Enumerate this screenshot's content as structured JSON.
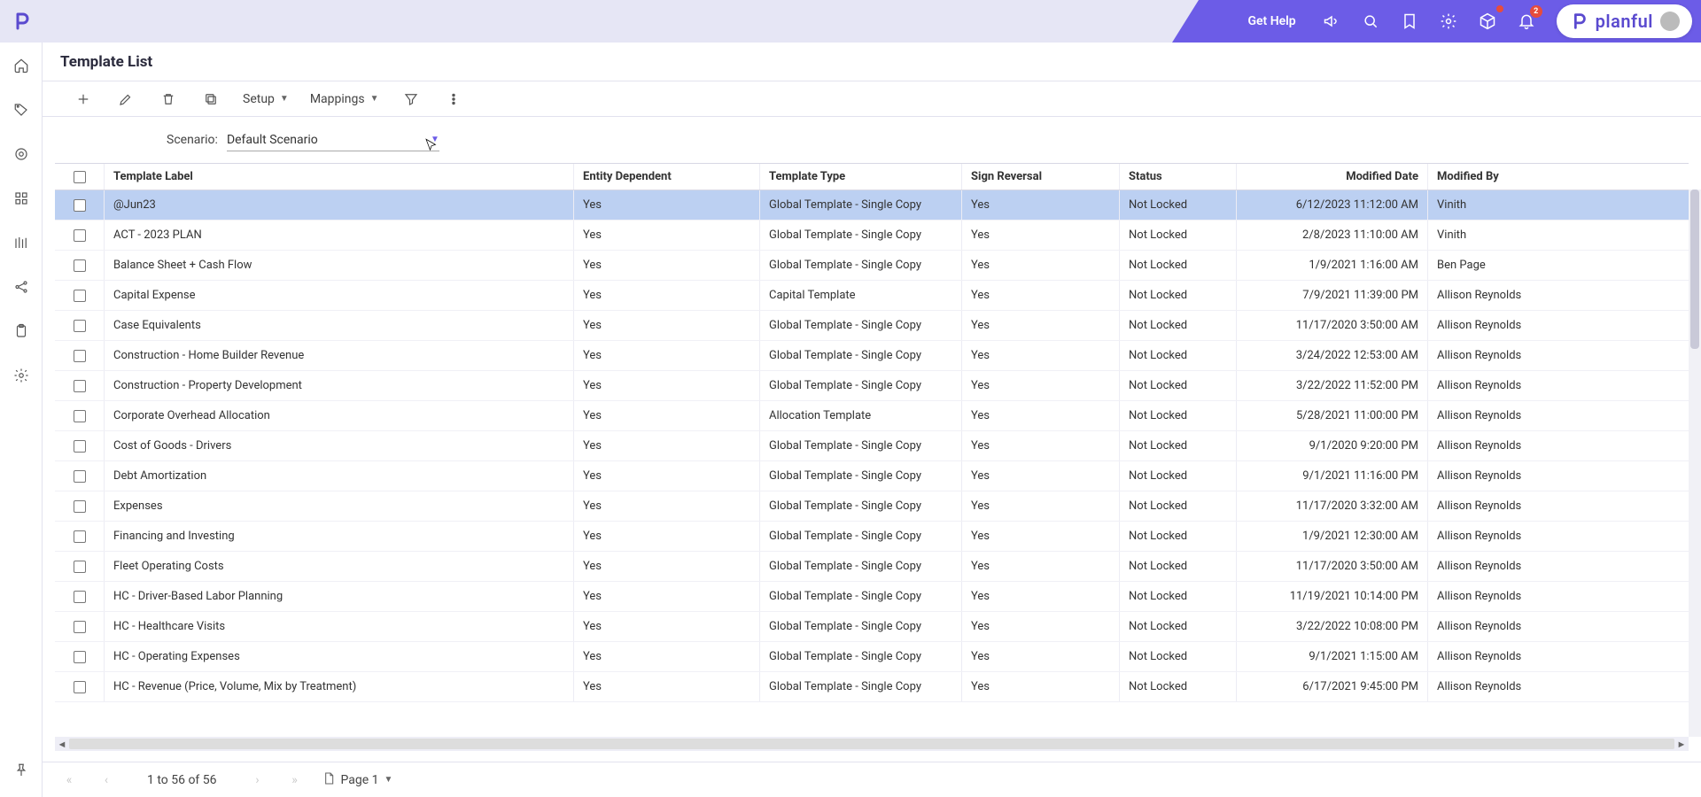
{
  "header": {
    "get_help": "Get Help",
    "brand_text": "planful",
    "notif_badge": "2"
  },
  "page": {
    "title": "Template List"
  },
  "toolbar": {
    "setup_label": "Setup",
    "mappings_label": "Mappings"
  },
  "scenario": {
    "label": "Scenario:",
    "value": "Default Scenario"
  },
  "table": {
    "columns": {
      "label": "Template Label",
      "entity": "Entity Dependent",
      "type": "Template Type",
      "sign": "Sign Reversal",
      "status": "Status",
      "date": "Modified Date",
      "by": "Modified By"
    },
    "rows": [
      {
        "label": "@Jun23",
        "entity": "Yes",
        "type": "Global Template - Single Copy",
        "sign": "Yes",
        "status": "Not Locked",
        "date": "6/12/2023 11:12:00 AM",
        "by": "Vinith",
        "selected": true
      },
      {
        "label": "ACT - 2023 PLAN",
        "entity": "Yes",
        "type": "Global Template - Single Copy",
        "sign": "Yes",
        "status": "Not Locked",
        "date": "2/8/2023 11:10:00 AM",
        "by": "Vinith"
      },
      {
        "label": "Balance Sheet + Cash Flow",
        "entity": "Yes",
        "type": "Global Template - Single Copy",
        "sign": "Yes",
        "status": "Not Locked",
        "date": "1/9/2021 1:16:00 AM",
        "by": "Ben Page"
      },
      {
        "label": "Capital Expense",
        "entity": "Yes",
        "type": "Capital Template",
        "sign": "Yes",
        "status": "Not Locked",
        "date": "7/9/2021 11:39:00 PM",
        "by": "Allison Reynolds"
      },
      {
        "label": "Case Equivalents",
        "entity": "Yes",
        "type": "Global Template - Single Copy",
        "sign": "Yes",
        "status": "Not Locked",
        "date": "11/17/2020 3:50:00 AM",
        "by": "Allison Reynolds"
      },
      {
        "label": "Construction - Home Builder Revenue",
        "entity": "Yes",
        "type": "Global Template - Single Copy",
        "sign": "Yes",
        "status": "Not Locked",
        "date": "3/24/2022 12:53:00 AM",
        "by": "Allison Reynolds"
      },
      {
        "label": "Construction - Property Development",
        "entity": "Yes",
        "type": "Global Template - Single Copy",
        "sign": "Yes",
        "status": "Not Locked",
        "date": "3/22/2022 11:52:00 PM",
        "by": "Allison Reynolds"
      },
      {
        "label": "Corporate Overhead Allocation",
        "entity": "Yes",
        "type": "Allocation Template",
        "sign": "Yes",
        "status": "Not Locked",
        "date": "5/28/2021 11:00:00 PM",
        "by": "Allison Reynolds"
      },
      {
        "label": "Cost of Goods - Drivers",
        "entity": "Yes",
        "type": "Global Template - Single Copy",
        "sign": "Yes",
        "status": "Not Locked",
        "date": "9/1/2020 9:20:00 PM",
        "by": "Allison Reynolds"
      },
      {
        "label": "Debt Amortization",
        "entity": "Yes",
        "type": "Global Template - Single Copy",
        "sign": "Yes",
        "status": "Not Locked",
        "date": "9/1/2021 11:16:00 PM",
        "by": "Allison Reynolds"
      },
      {
        "label": "Expenses",
        "entity": "Yes",
        "type": "Global Template - Single Copy",
        "sign": "Yes",
        "status": "Not Locked",
        "date": "11/17/2020 3:32:00 AM",
        "by": "Allison Reynolds"
      },
      {
        "label": "Financing and Investing",
        "entity": "Yes",
        "type": "Global Template - Single Copy",
        "sign": "Yes",
        "status": "Not Locked",
        "date": "1/9/2021 12:30:00 AM",
        "by": "Allison Reynolds"
      },
      {
        "label": "Fleet Operating Costs",
        "entity": "Yes",
        "type": "Global Template - Single Copy",
        "sign": "Yes",
        "status": "Not Locked",
        "date": "11/17/2020 3:50:00 AM",
        "by": "Allison Reynolds"
      },
      {
        "label": "HC - Driver-Based Labor Planning",
        "entity": "Yes",
        "type": "Global Template - Single Copy",
        "sign": "Yes",
        "status": "Not Locked",
        "date": "11/19/2021 10:14:00 PM",
        "by": "Allison Reynolds"
      },
      {
        "label": "HC - Healthcare Visits",
        "entity": "Yes",
        "type": "Global Template - Single Copy",
        "sign": "Yes",
        "status": "Not Locked",
        "date": "3/22/2022 10:08:00 PM",
        "by": "Allison Reynolds"
      },
      {
        "label": "HC - Operating Expenses",
        "entity": "Yes",
        "type": "Global Template - Single Copy",
        "sign": "Yes",
        "status": "Not Locked",
        "date": "9/1/2021 1:15:00 AM",
        "by": "Allison Reynolds"
      },
      {
        "label": "HC - Revenue (Price, Volume, Mix by Treatment)",
        "entity": "Yes",
        "type": "Global Template - Single Copy",
        "sign": "Yes",
        "status": "Not Locked",
        "date": "6/17/2021 9:45:00 PM",
        "by": "Allison Reynolds"
      }
    ]
  },
  "footer": {
    "range": "1 to 56 of 56",
    "page_label": "Page 1"
  }
}
